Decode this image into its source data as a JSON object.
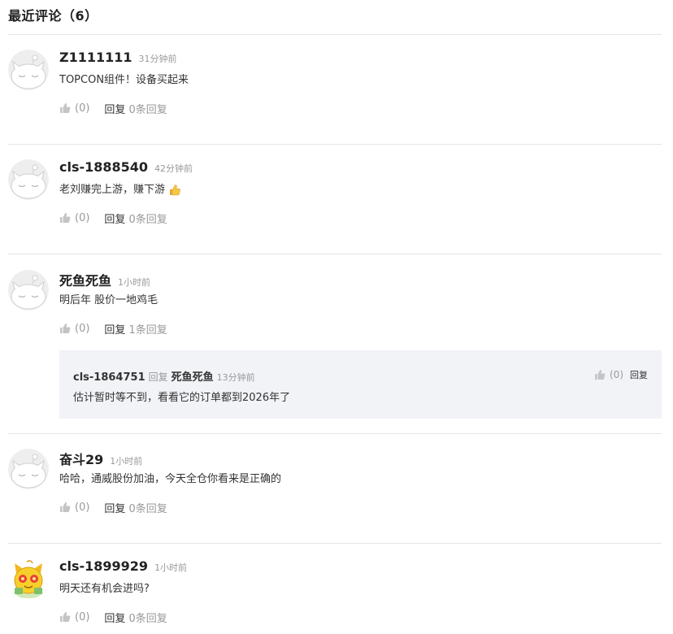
{
  "header": {
    "title": "最近评论（6）"
  },
  "comments": [
    {
      "user": "Z1111111",
      "time": "31分钟前",
      "text": "TOPCON组件！设备买起来",
      "likes": "(0)",
      "reply_label": "回复",
      "reply_count": "0条回复",
      "avatar": "default"
    },
    {
      "user": "cls-1888540",
      "time": "42分钟前",
      "text": "老刘赚完上游，赚下游",
      "likes": "(0)",
      "reply_label": "回复",
      "reply_count": "0条回复",
      "avatar": "default",
      "emoji": "thumbs-up"
    },
    {
      "user": "死鱼死鱼",
      "time": "1小时前",
      "text": "明后年 股价一地鸡毛",
      "likes": "(0)",
      "reply_label": "回复",
      "reply_count": "1条回复",
      "avatar": "default"
    },
    {
      "user": "奋斗29",
      "time": "1小时前",
      "text": "哈哈，通威股份加油，今天全仓你看来是正确的",
      "likes": "(0)",
      "reply_label": "回复",
      "reply_count": "0条回复",
      "avatar": "default"
    },
    {
      "user": "cls-1899929",
      "time": "1小时前",
      "text": "明天还有机会进吗?",
      "likes": "(0)",
      "reply_label": "回复",
      "reply_count": "0条回复",
      "avatar": "custom-cat"
    }
  ],
  "sub_reply": {
    "user": "cls-1864751",
    "reply_word": "回复",
    "target": "死鱼死鱼",
    "time": "13分钟前",
    "text": "估计暂时等不到，看看它的订单都到2026年了",
    "likes": "(0)",
    "reply_label": "回复"
  },
  "colors": {
    "muted": "#999999",
    "text": "#333333",
    "divider": "#e5e5e5",
    "sub_bg": "#f2f3f7"
  }
}
